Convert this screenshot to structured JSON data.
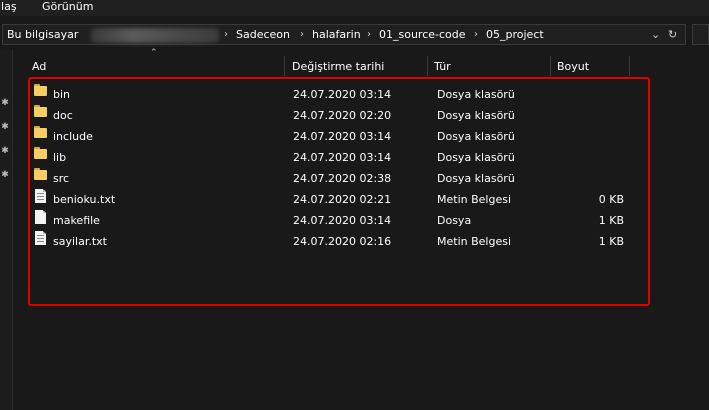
{
  "menu": {
    "items": [
      "ılaş",
      "Görünüm"
    ]
  },
  "address": {
    "crumbs": [
      "Bu bilgisayar",
      "Sadeceon",
      "halafarin",
      "01_source-code",
      "05_project"
    ],
    "dropdown_glyph": "⌄",
    "refresh_glyph": "↻"
  },
  "columns": {
    "name": "Ad",
    "date": "Değiştirme tarihi",
    "type": "Tür",
    "size": "Boyut"
  },
  "files": [
    {
      "name": "bin",
      "date": "24.07.2020 03:14",
      "type": "Dosya klasörü",
      "size": "",
      "icon": "folder-icon"
    },
    {
      "name": "doc",
      "date": "24.07.2020 02:20",
      "type": "Dosya klasörü",
      "size": "",
      "icon": "folder-icon"
    },
    {
      "name": "include",
      "date": "24.07.2020 03:14",
      "type": "Dosya klasörü",
      "size": "",
      "icon": "folder-icon"
    },
    {
      "name": "lib",
      "date": "24.07.2020 03:14",
      "type": "Dosya klasörü",
      "size": "",
      "icon": "folder-icon"
    },
    {
      "name": "src",
      "date": "24.07.2020 02:38",
      "type": "Dosya klasörü",
      "size": "",
      "icon": "folder-icon"
    },
    {
      "name": "benioku.txt",
      "date": "24.07.2020 02:21",
      "type": "Metin Belgesi",
      "size": "0 KB",
      "icon": "text-file-icon"
    },
    {
      "name": "makefile",
      "date": "24.07.2020 03:14",
      "type": "Dosya",
      "size": "1 KB",
      "icon": "file-icon"
    },
    {
      "name": "sayilar.txt",
      "date": "24.07.2020 02:16",
      "type": "Metin Belgesi",
      "size": "1 KB",
      "icon": "text-file-icon"
    }
  ],
  "colors": {
    "highlight": "#e00000",
    "background": "#191919",
    "folder": "#f5cf64"
  }
}
